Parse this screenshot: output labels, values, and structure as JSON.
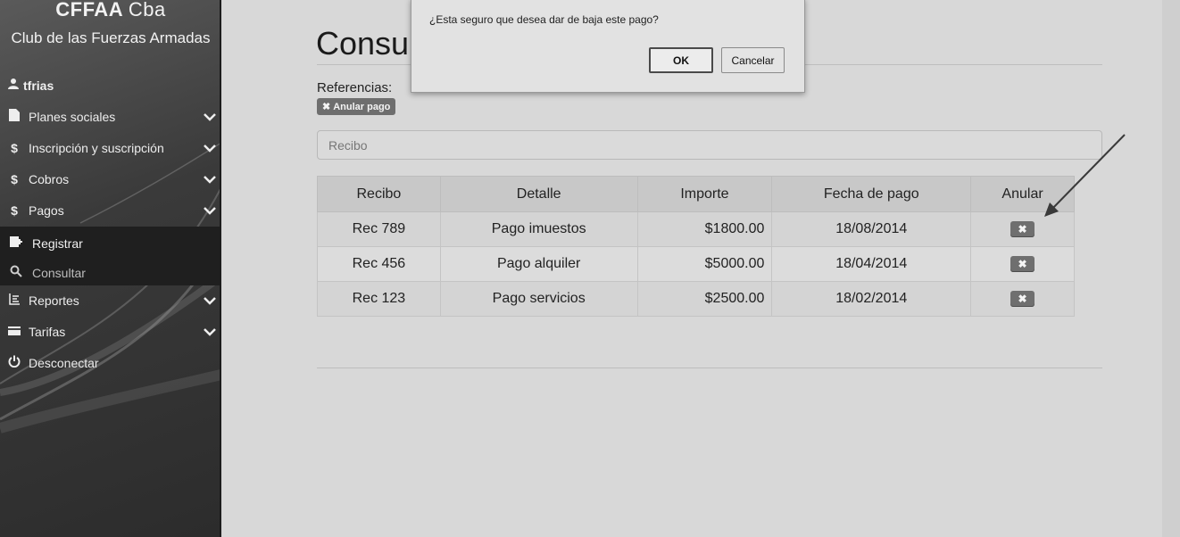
{
  "sidebar": {
    "brand_bold": "CFFAA",
    "brand_light": "Cba",
    "brand_sub": "Club de las Fuerzas Armadas",
    "user": "tfrias",
    "items": [
      {
        "label": "Planes sociales",
        "icon": "document-icon"
      },
      {
        "label": "Inscripción y suscripción",
        "icon": "dollar-icon"
      },
      {
        "label": "Cobros",
        "icon": "dollar-icon"
      },
      {
        "label": "Pagos",
        "icon": "dollar-icon"
      }
    ],
    "submenu": [
      {
        "label": "Registrar",
        "icon": "register-icon"
      },
      {
        "label": "Consultar",
        "icon": "search-icon"
      }
    ],
    "items_after": [
      {
        "label": "Reportes",
        "icon": "reports-icon"
      },
      {
        "label": "Tarifas",
        "icon": "card-icon"
      },
      {
        "label": "Desconectar",
        "icon": "power-icon"
      }
    ]
  },
  "main": {
    "title": "Consu",
    "references_label": "Referencias:",
    "badge_label": "Anular pago",
    "search_placeholder": "Recibo",
    "table": {
      "headers": [
        "Recibo",
        "Detalle",
        "Importe",
        "Fecha de pago",
        "Anular"
      ],
      "rows": [
        {
          "recibo": "Rec 789",
          "detalle": "Pago imuestos",
          "importe": "$1800.00",
          "fecha": "18/08/2014"
        },
        {
          "recibo": "Rec 456",
          "detalle": "Pago alquiler",
          "importe": "$5000.00",
          "fecha": "18/04/2014"
        },
        {
          "recibo": "Rec 123",
          "detalle": "Pago servicios",
          "importe": "$2500.00",
          "fecha": "18/02/2014"
        }
      ]
    }
  },
  "dialog": {
    "message": "¿Esta seguro que desea dar de baja este pago?",
    "ok_label": "OK",
    "cancel_label": "Cancelar"
  }
}
